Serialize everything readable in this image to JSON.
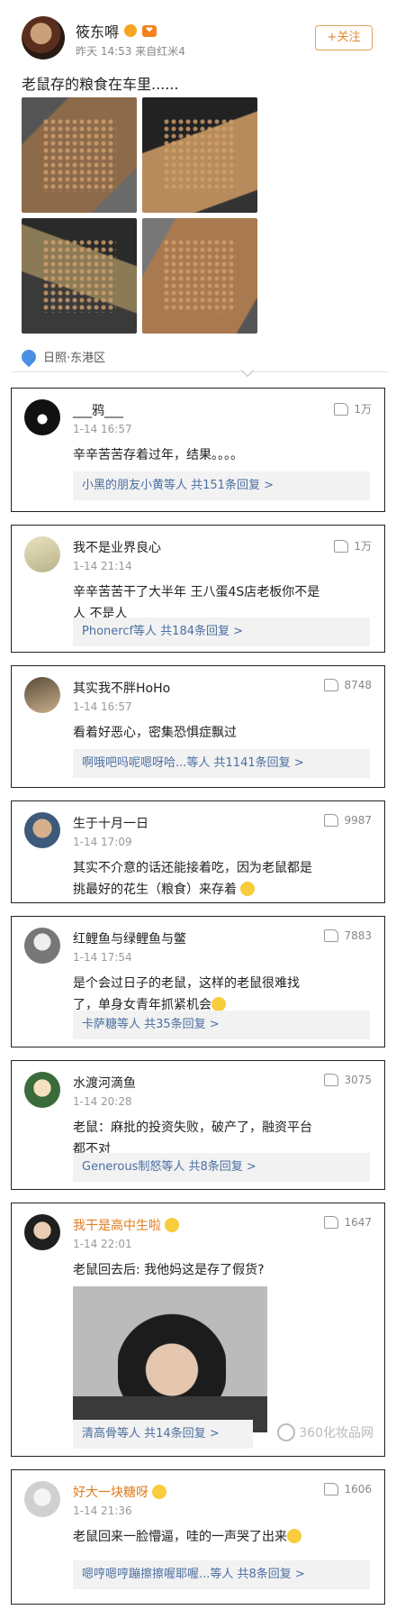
{
  "post": {
    "author": "筱东嘚",
    "vip_badge": "❤",
    "time": "昨天 14:53",
    "source": "来自红米4",
    "follow_label": "+关注",
    "text": "老鼠存的粮食在车里......",
    "location": "日照·东港区"
  },
  "comments": [
    {
      "name": "___鸦___",
      "time": "1-14 16:57",
      "likes": "1万",
      "lines": [
        "辛辛苦苦存着过年，结果。。。。"
      ],
      "replies": "小黑的朋友小黄等人 共151条回复 >"
    },
    {
      "name": "我不是业界良心",
      "time": "1-14 21:14",
      "likes": "1万",
      "lines": [
        "辛辛苦苦干了大半年 王八蛋4S店老板你不是",
        "人 不是人"
      ],
      "replies": "Phonercf等人 共184条回复 >"
    },
    {
      "name": "其实我不胖HoHo",
      "time": "1-14 16:57",
      "likes": "8748",
      "lines": [
        "看着好恶心，密集恐惧症飘过"
      ],
      "replies": "啊哦吧吗呢嗯呀哈...等人 共1141条回复 >"
    },
    {
      "name": "生于十月一日",
      "time": "1-14 17:09",
      "likes": "9987",
      "lines": [
        "其实不介意的话还能接着吃，因为老鼠都是",
        "挑最好的花生（粮食）来存着"
      ],
      "replies": ""
    },
    {
      "name": "红鲤鱼与绿鲤鱼与鳖",
      "time": "1-14 17:54",
      "likes": "7883",
      "lines": [
        "是个会过日子的老鼠，这样的老鼠很难找",
        "了，单身女青年抓紧机会"
      ],
      "replies": "卡萨糖等人 共35条回复 >"
    },
    {
      "name": "水渡河滴鱼",
      "time": "1-14 20:28",
      "likes": "3075",
      "lines": [
        "老鼠：麻批的投资失败，破产了，融资平台",
        "都不对"
      ],
      "replies": "Generous制怒等人 共8条回复 >"
    },
    {
      "name": "我干是高中生啦",
      "time": "1-14 22:01",
      "likes": "1647",
      "lines": [
        "老鼠回去后: 我他妈这是存了假货?"
      ],
      "replies": "清高骨等人 共14条回复 >"
    },
    {
      "name": "好大一块糖呀",
      "time": "1-14 21:36",
      "likes": "1606",
      "lines": [
        "老鼠回来一脸懵逼，哇的一声哭了出来"
      ],
      "replies": "嗯哼嗯哼蹦擦擦喔耶喔...等人 共8条回复 >"
    }
  ],
  "watermark": "360化妆品网"
}
